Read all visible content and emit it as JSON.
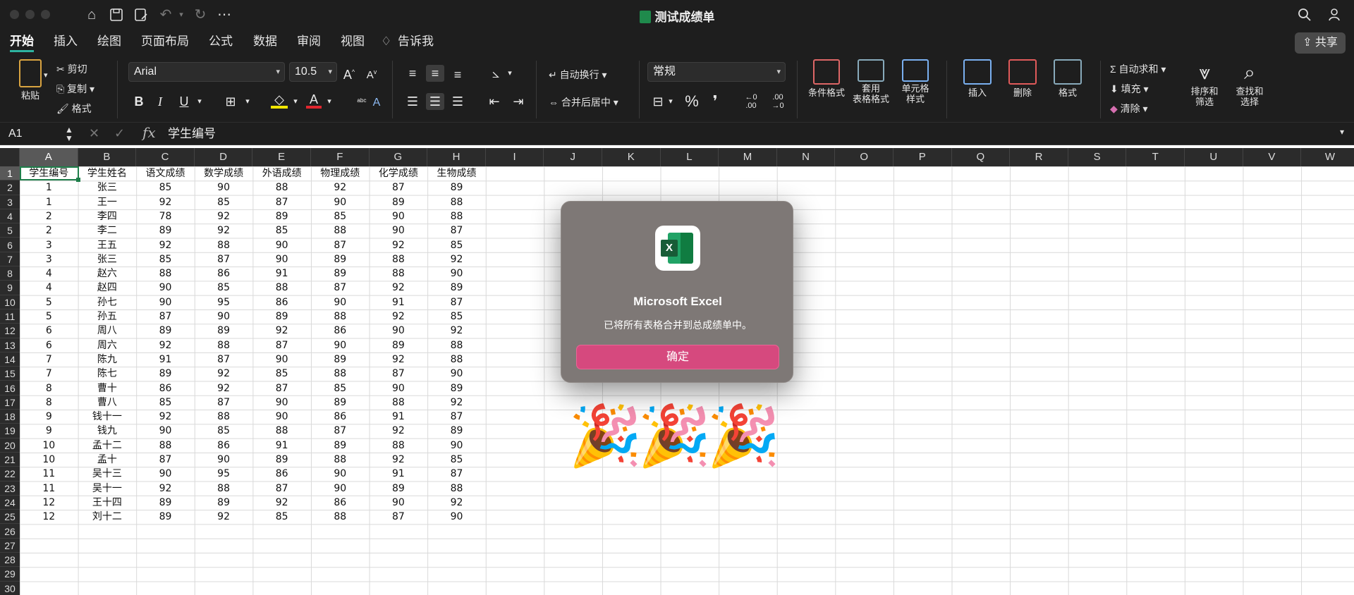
{
  "window": {
    "title": "测试成绩单"
  },
  "tabs": [
    "开始",
    "插入",
    "绘图",
    "页面布局",
    "公式",
    "数据",
    "审阅",
    "视图",
    "告诉我"
  ],
  "share_label": "共享",
  "ribbon": {
    "paste": "粘贴",
    "cut": "剪切",
    "copy": "复制",
    "format_painter": "格式",
    "font_name": "Arial",
    "font_size": "10.5",
    "bold": "B",
    "italic": "I",
    "underline": "U",
    "wrap_text": "自动换行",
    "merge_center": "合并后居中",
    "number_format": "常规",
    "percent": "%",
    "conditional_format": "条件格式",
    "table_format_1": "套用",
    "table_format_2": "表格格式",
    "cell_styles_1": "单元格",
    "cell_styles_2": "样式",
    "insert": "插入",
    "delete": "删除",
    "format": "格式",
    "autosum": "自动求和",
    "fill": "填充",
    "clear": "清除",
    "sort_filter_1": "排序和",
    "sort_filter_2": "筛选",
    "find_select_1": "查找和",
    "find_select_2": "选择"
  },
  "formula_bar": {
    "name_box": "A1",
    "fx": "fx",
    "content": "学生编号"
  },
  "columns": [
    "A",
    "B",
    "C",
    "D",
    "E",
    "F",
    "G",
    "H",
    "I",
    "J",
    "K",
    "L",
    "M",
    "N",
    "O",
    "P",
    "Q",
    "R",
    "S",
    "T",
    "U",
    "V",
    "W"
  ],
  "rows": [
    "1",
    "2",
    "3",
    "4",
    "5",
    "6",
    "7",
    "8",
    "9",
    "10",
    "11",
    "12",
    "13",
    "14",
    "15",
    "16",
    "17",
    "18",
    "19",
    "20",
    "21",
    "22",
    "23",
    "24",
    "25",
    "26",
    "27",
    "28",
    "29",
    "30"
  ],
  "table": {
    "headers": [
      "学生编号",
      "学生姓名",
      "语文成绩",
      "数学成绩",
      "外语成绩",
      "物理成绩",
      "化学成绩",
      "生物成绩"
    ],
    "rows": [
      [
        "1",
        "张三",
        "85",
        "90",
        "88",
        "92",
        "87",
        "89"
      ],
      [
        "1",
        "王一",
        "92",
        "85",
        "87",
        "90",
        "89",
        "88"
      ],
      [
        "2",
        "李四",
        "78",
        "92",
        "89",
        "85",
        "90",
        "88"
      ],
      [
        "2",
        "李二",
        "89",
        "92",
        "85",
        "88",
        "90",
        "87"
      ],
      [
        "3",
        "王五",
        "92",
        "88",
        "90",
        "87",
        "92",
        "85"
      ],
      [
        "3",
        "张三",
        "85",
        "87",
        "90",
        "89",
        "88",
        "92"
      ],
      [
        "4",
        "赵六",
        "88",
        "86",
        "91",
        "89",
        "88",
        "90"
      ],
      [
        "4",
        "赵四",
        "90",
        "85",
        "88",
        "87",
        "92",
        "89"
      ],
      [
        "5",
        "孙七",
        "90",
        "95",
        "86",
        "90",
        "91",
        "87"
      ],
      [
        "5",
        "孙五",
        "87",
        "90",
        "89",
        "88",
        "92",
        "85"
      ],
      [
        "6",
        "周八",
        "89",
        "89",
        "92",
        "86",
        "90",
        "92"
      ],
      [
        "6",
        "周六",
        "92",
        "88",
        "87",
        "90",
        "89",
        "88"
      ],
      [
        "7",
        "陈九",
        "91",
        "87",
        "90",
        "89",
        "92",
        "88"
      ],
      [
        "7",
        "陈七",
        "89",
        "92",
        "85",
        "88",
        "87",
        "90"
      ],
      [
        "8",
        "曹十",
        "86",
        "92",
        "87",
        "85",
        "90",
        "89"
      ],
      [
        "8",
        "曹八",
        "85",
        "87",
        "90",
        "89",
        "88",
        "92"
      ],
      [
        "9",
        "钱十一",
        "92",
        "88",
        "90",
        "86",
        "91",
        "87"
      ],
      [
        "9",
        "钱九",
        "90",
        "85",
        "88",
        "87",
        "92",
        "89"
      ],
      [
        "10",
        "孟十二",
        "88",
        "86",
        "91",
        "89",
        "88",
        "90"
      ],
      [
        "10",
        "孟十",
        "87",
        "90",
        "89",
        "88",
        "92",
        "85"
      ],
      [
        "11",
        "吴十三",
        "90",
        "95",
        "86",
        "90",
        "91",
        "87"
      ],
      [
        "11",
        "吴十一",
        "92",
        "88",
        "87",
        "90",
        "89",
        "88"
      ],
      [
        "12",
        "王十四",
        "89",
        "89",
        "92",
        "86",
        "90",
        "92"
      ],
      [
        "12",
        "刘十二",
        "89",
        "92",
        "85",
        "88",
        "87",
        "90"
      ]
    ]
  },
  "dialog": {
    "title": "Microsoft Excel",
    "message": "已将所有表格合并到总成绩单中。",
    "ok": "确定",
    "logo_letter": "X"
  },
  "decor": {
    "popper": "🎉"
  },
  "colors": {
    "accent_tab": "#2db3a0",
    "ok_button": "#d6497e",
    "dialog_bg": "#7e7876"
  }
}
